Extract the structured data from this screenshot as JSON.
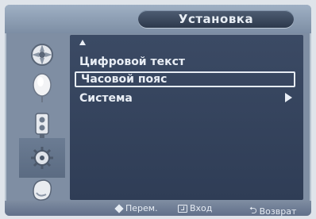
{
  "header": {
    "title": "Установка"
  },
  "sidebar": {
    "items": [
      {
        "icon": "picture-icon",
        "selected": false
      },
      {
        "icon": "sound-icon",
        "selected": false
      },
      {
        "icon": "channel-icon",
        "selected": false
      },
      {
        "icon": "setup-icon",
        "selected": true
      },
      {
        "icon": "input-icon",
        "selected": false
      }
    ]
  },
  "menu": {
    "scroll_up_icon": "up-arrow-icon",
    "items": [
      {
        "label": "Цифровой текст",
        "selected": false,
        "has_submenu": false
      },
      {
        "label": "Часовой пояс",
        "selected": true,
        "has_submenu": false
      },
      {
        "label": "Система",
        "selected": false,
        "has_submenu": true
      }
    ]
  },
  "footer": {
    "move_label": "Перем.",
    "enter_label": "Вход",
    "return_label": "Возврат"
  }
}
